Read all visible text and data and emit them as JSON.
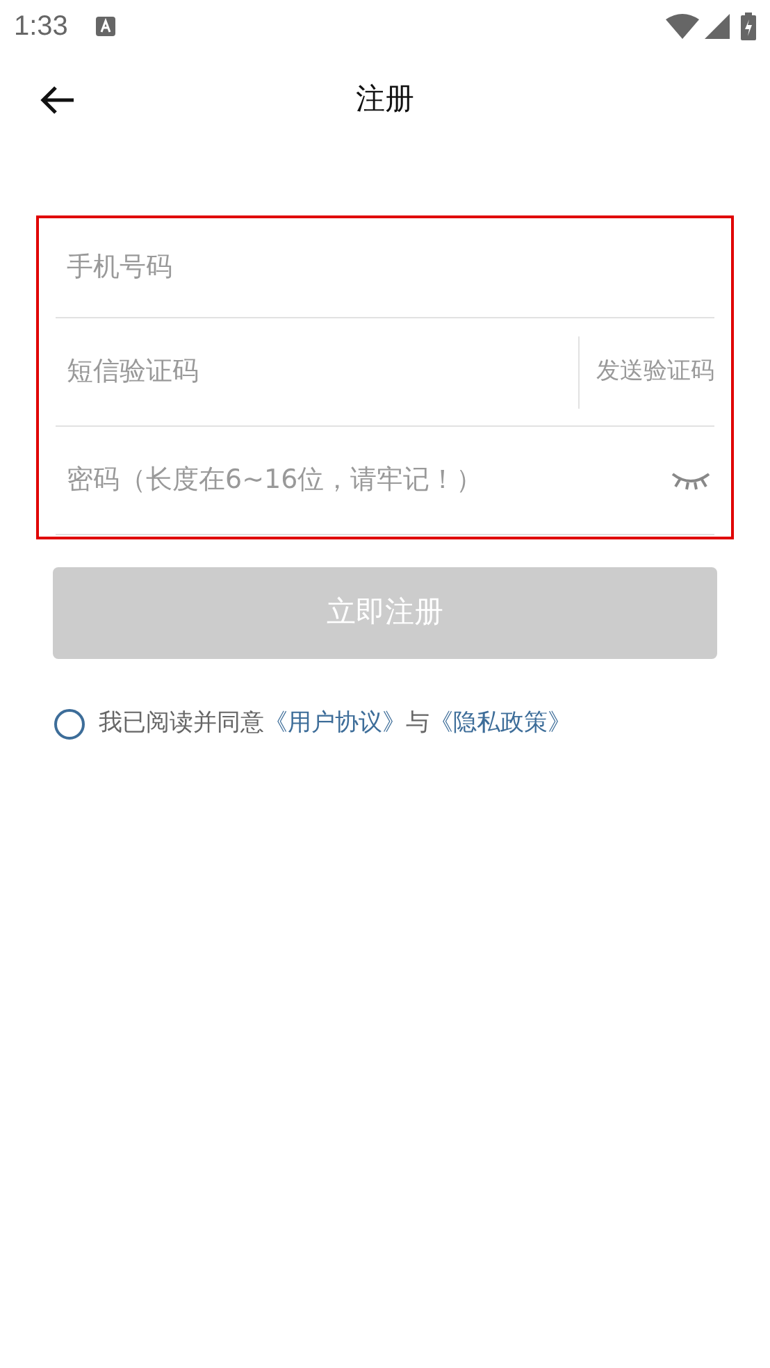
{
  "status_bar": {
    "time": "1:33"
  },
  "header": {
    "title": "注册"
  },
  "form": {
    "highlighted": true,
    "phone": {
      "placeholder": "手机号码"
    },
    "sms_code": {
      "placeholder": "短信验证码",
      "send_button": "发送验证码"
    },
    "password": {
      "placeholder": "密码（长度在6~16位，请牢记！）",
      "visible": false
    }
  },
  "submit": {
    "label": "立即注册",
    "disabled": true
  },
  "agreement": {
    "checked": false,
    "text": "我已阅读并同意",
    "link_1": "《用户协议》",
    "joiner": "与",
    "link_2": "《隐私政策》"
  }
}
